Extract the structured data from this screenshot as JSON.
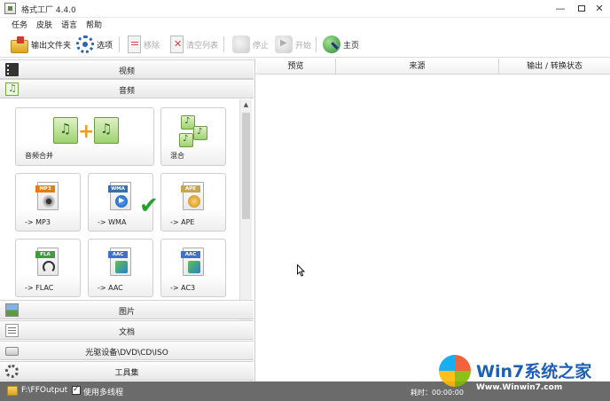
{
  "window": {
    "title": "格式工厂 4.4.0",
    "min_glyph": "—",
    "close_glyph": "✕"
  },
  "menu": [
    "任务",
    "皮肤",
    "语言",
    "帮助"
  ],
  "toolbar": {
    "output_folder": "输出文件夹",
    "options": "选项",
    "remove": "移除",
    "clear_list": "清空列表",
    "stop": "停止",
    "start": "开始",
    "home": "主页"
  },
  "categories": {
    "video": "视频",
    "audio": "音频",
    "picture": "图片",
    "document": "文档",
    "disc": "光驱设备\\DVD\\CD\\ISO",
    "tools": "工具集"
  },
  "audio_tools": [
    {
      "label": "音频合并"
    },
    {
      "label": "混合"
    },
    {
      "label": "-> MP3",
      "tag": "MP3"
    },
    {
      "label": "-> WMA",
      "tag": "WMA"
    },
    {
      "label": "-> APE",
      "tag": "APE"
    },
    {
      "label": "-> FLAC",
      "tag": "FLA"
    },
    {
      "label": "-> AAC",
      "tag": "AAC"
    },
    {
      "label": "-> AC3",
      "tag": "AAC"
    }
  ],
  "task_table": {
    "columns": [
      "预览",
      "来源",
      "输出 / 转换状态"
    ]
  },
  "statusbar": {
    "output_path": "F:\\FFOutput",
    "multithread_label": "使用多线程",
    "multithread_checked": true,
    "time_label": "耗时：00:00:00"
  },
  "watermark": {
    "brand": "Win7系统之家",
    "url": "Www.Winwin7.com"
  },
  "colors": {
    "statusbar_bg": "#6b6b6b",
    "check_green": "#22a22a",
    "brand_blue": "#1d5fb5"
  }
}
